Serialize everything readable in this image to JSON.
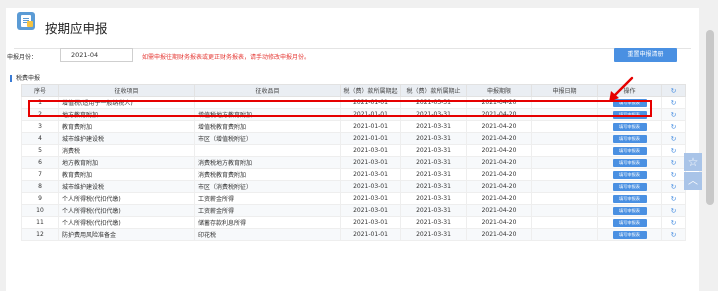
{
  "page": {
    "title": "按期应申报",
    "period_label": "申报月份：",
    "period_value": "2021-04",
    "notice": "如需申报往期财务报表或更正财务报表，请手动修改申报月份。",
    "reset_button": "重置申报清册",
    "section_title": "税费申报"
  },
  "table": {
    "headers": {
      "index": "序号",
      "levy_item": "征收项目",
      "levy_category": "征收品目",
      "period_start": "税（费）款所属期起",
      "period_end": "税（费）款所属期止",
      "deadline": "申报期限",
      "declare_date": "申报日期",
      "action": "操作"
    },
    "action_label": "填写申报表",
    "rows": [
      {
        "index": "1",
        "levy_item": "增值税(适用于一般纳税人)",
        "levy_category": "",
        "period_start": "2021-01-01",
        "period_end": "2021-03-31",
        "deadline": "2021-04-20",
        "declare_date": ""
      },
      {
        "index": "2",
        "levy_item": "地方教育附加",
        "levy_category": "增值税地方教育附加",
        "period_start": "2021-01-01",
        "period_end": "2021-03-31",
        "deadline": "2021-04-20",
        "declare_date": ""
      },
      {
        "index": "3",
        "levy_item": "教育费附加",
        "levy_category": "增值税教育费附加",
        "period_start": "2021-01-01",
        "period_end": "2021-03-31",
        "deadline": "2021-04-20",
        "declare_date": ""
      },
      {
        "index": "4",
        "levy_item": "城市维护建设税",
        "levy_category": "市区（增值税附征）",
        "period_start": "2021-01-01",
        "period_end": "2021-03-31",
        "deadline": "2021-04-20",
        "declare_date": ""
      },
      {
        "index": "5",
        "levy_item": "消费税",
        "levy_category": "",
        "period_start": "2021-03-01",
        "period_end": "2021-03-31",
        "deadline": "2021-04-20",
        "declare_date": ""
      },
      {
        "index": "6",
        "levy_item": "地方教育附加",
        "levy_category": "消费税地方教育附加",
        "period_start": "2021-03-01",
        "period_end": "2021-03-31",
        "deadline": "2021-04-20",
        "declare_date": ""
      },
      {
        "index": "7",
        "levy_item": "教育费附加",
        "levy_category": "消费税教育费附加",
        "period_start": "2021-03-01",
        "period_end": "2021-03-31",
        "deadline": "2021-04-20",
        "declare_date": ""
      },
      {
        "index": "8",
        "levy_item": "城市维护建设税",
        "levy_category": "市区（消费税附征）",
        "period_start": "2021-03-01",
        "period_end": "2021-03-31",
        "deadline": "2021-04-20",
        "declare_date": ""
      },
      {
        "index": "9",
        "levy_item": "个人所得税(代扣代缴)",
        "levy_category": "工资薪金所得",
        "period_start": "2021-03-01",
        "period_end": "2021-03-31",
        "deadline": "2021-04-20",
        "declare_date": ""
      },
      {
        "index": "10",
        "levy_item": "个人所得税(代扣代缴)",
        "levy_category": "工资薪金所得",
        "period_start": "2021-03-01",
        "period_end": "2021-03-31",
        "deadline": "2021-04-20",
        "declare_date": ""
      },
      {
        "index": "11",
        "levy_item": "个人所得税(代扣代缴)",
        "levy_category": "储蓄存款利息所得",
        "period_start": "2021-03-01",
        "period_end": "2021-03-31",
        "deadline": "2021-04-20",
        "declare_date": ""
      },
      {
        "index": "12",
        "levy_item": "防护费用风险准备金",
        "levy_category": "印花税",
        "period_start": "2021-01-01",
        "period_end": "2021-03-31",
        "deadline": "2021-04-20",
        "declare_date": ""
      }
    ]
  },
  "icons": {
    "title": "document-folder-icon",
    "refresh": "refresh-icon",
    "favorite": "star-icon",
    "back_to_top": "chevron-up-icon"
  },
  "colors": {
    "accent": "#4a90e2",
    "notice": "#e53935",
    "highlight": "#e60000",
    "header_bg": "#eaeef3"
  }
}
